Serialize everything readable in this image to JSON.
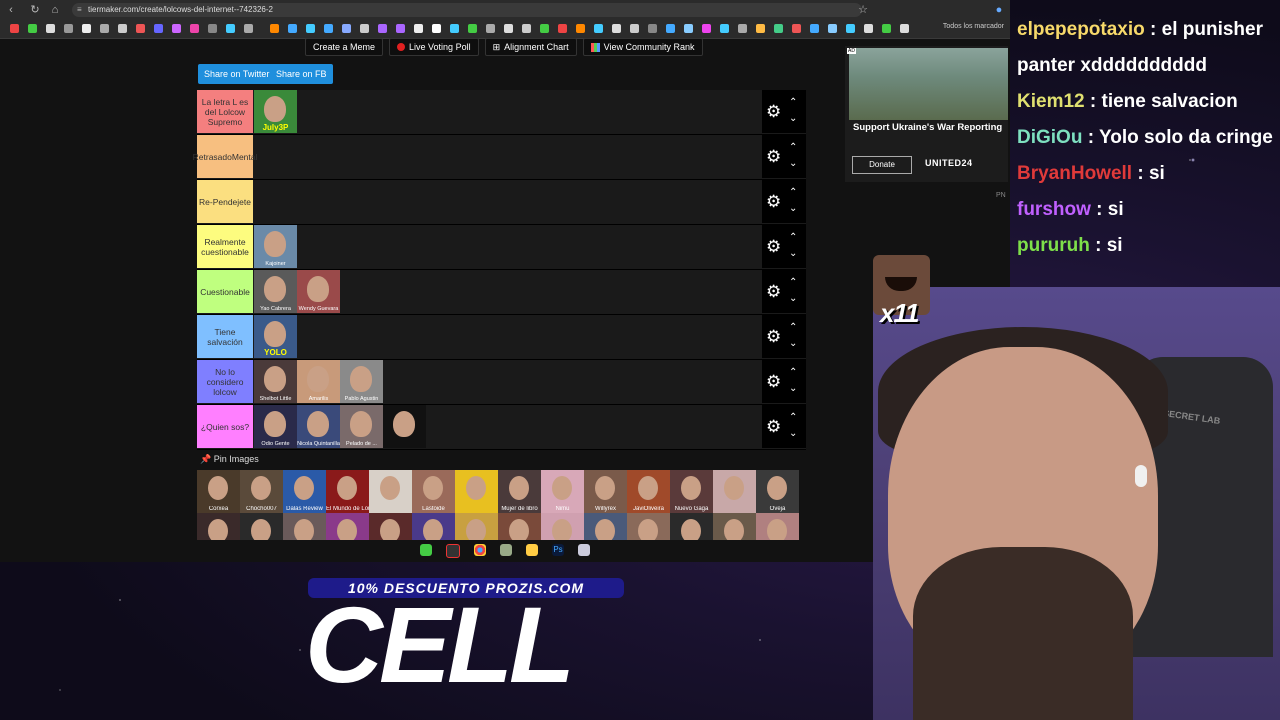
{
  "browser": {
    "url": "tiermaker.com/create/lolcows-del-internet--742326-2",
    "bookmarks_overflow": "Todos los marcador"
  },
  "page": {
    "top_buttons": [
      "Create a Meme",
      "Live Voting Poll",
      "Alignment Chart",
      "View Community Rank"
    ],
    "share_twitter": "Share on Twitter",
    "share_fb": "Share on FB",
    "pin_images": "Pin Images",
    "tiers": [
      {
        "label": "La letra L es del Lolcow Supremo",
        "color": "#f47f7f",
        "images": [
          {
            "caption": "July3P",
            "big": true,
            "bg": "#3a8a3a"
          }
        ]
      },
      {
        "label": "RetrasadoMental",
        "color": "#f7bf80",
        "images": []
      },
      {
        "label": "Re-Pendejete",
        "color": "#fbdf80",
        "images": []
      },
      {
        "label": "Realmente cuestionable",
        "color": "#fdfc7f",
        "images": [
          {
            "caption": "Kajoiner",
            "bg": "#6a8aa8"
          }
        ]
      },
      {
        "label": "Cuestionable",
        "color": "#bfff7f",
        "images": [
          {
            "caption": "Yao Cabrera",
            "bg": "#5a5a5a"
          },
          {
            "caption": "Wendy Guevara",
            "bg": "#9a4a4a"
          }
        ]
      },
      {
        "label": "Tiene salvación",
        "color": "#7fbfff",
        "images": [
          {
            "caption": "YOLO",
            "big": true,
            "bg": "#3a5a8a"
          }
        ]
      },
      {
        "label": "No lo considero lolcow",
        "color": "#7f7fff",
        "images": [
          {
            "caption": "Shelbot Little",
            "bg": "#4a3a3a"
          },
          {
            "caption": "Amarilis",
            "bg": "#c89a7a"
          },
          {
            "caption": "Pablo Agustin",
            "bg": "#8a8a8a"
          }
        ]
      },
      {
        "label": "¿Quien sos?",
        "color": "#ff7fff",
        "images": [
          {
            "caption": "Odio Gente",
            "bg": "#2a2a4a"
          },
          {
            "caption": "Nicola Quintanilla",
            "bg": "#3a4a7a"
          },
          {
            "caption": "Pelado de ...",
            "bg": "#7a6a6a"
          },
          {
            "caption": "",
            "bg": "#111111"
          }
        ]
      }
    ],
    "pool": [
      {
        "caption": "Corxea",
        "bg": "#4a3a2a"
      },
      {
        "caption": "Chocho007",
        "bg": "#5a4a3a"
      },
      {
        "caption": "Dalas Review",
        "bg": "#2a5aa8"
      },
      {
        "caption": "El Mundo de Lore",
        "bg": "#8a1a1a"
      },
      {
        "caption": "",
        "bg": "#d8d0c8"
      },
      {
        "caption": "Lastoide",
        "bg": "#9a6a5a"
      },
      {
        "caption": "",
        "bg": "#e8c020"
      },
      {
        "caption": "Mujer de libro",
        "bg": "#4a3a3a"
      },
      {
        "caption": "Nimu",
        "bg": "#d8a8b8"
      },
      {
        "caption": "Willyrex",
        "bg": "#7a5a4a"
      },
      {
        "caption": "JaviOliveira",
        "bg": "#a04a2a"
      },
      {
        "caption": "Nuevo Gaga",
        "bg": "#5a3a3a"
      },
      {
        "caption": "",
        "bg": "#c8a8a8"
      },
      {
        "caption": "Oveja",
        "bg": "#3a3a3a"
      },
      {
        "caption": "",
        "bg": "#3a2a2a"
      },
      {
        "caption": "",
        "bg": "#2a2a2a"
      },
      {
        "caption": "",
        "bg": "#6a5a5a"
      },
      {
        "caption": "",
        "bg": "#8a3a8a"
      },
      {
        "caption": "",
        "bg": "#5a2a2a"
      },
      {
        "caption": "",
        "bg": "#4a3a8a"
      },
      {
        "caption": "",
        "bg": "#c8a040"
      },
      {
        "caption": "",
        "bg": "#7a4a3a"
      },
      {
        "caption": "",
        "bg": "#d0a0b0"
      },
      {
        "caption": "",
        "bg": "#4a5a7a"
      },
      {
        "caption": "",
        "bg": "#8a6a5a"
      },
      {
        "caption": "",
        "bg": "#2a2a2a"
      },
      {
        "caption": "",
        "bg": "#6a5a4a"
      },
      {
        "caption": "",
        "bg": "#b08080"
      }
    ]
  },
  "ad": {
    "tag": "AD",
    "title": "Support Ukraine's War Reporting",
    "donate": "Donate",
    "brand": "UNITED24",
    "pn": "PN"
  },
  "chat": [
    {
      "user": "elpepepotaxio",
      "color": "#f7d96a",
      "text": "el punisher panter xdddddddddd"
    },
    {
      "user": "Kiem12",
      "color": "#e0e070",
      "text": "tiene salvacion"
    },
    {
      "user": "DiGiOu",
      "color": "#7ee0c0",
      "text": "Yolo solo da cringe"
    },
    {
      "user": "BryanHowell",
      "color": "#e03a3a",
      "text": "si"
    },
    {
      "user": "furshow",
      "color": "#c060ff",
      "text": "si"
    },
    {
      "user": "pururuh",
      "color": "#7ee04a",
      "text": "si"
    }
  ],
  "emote": {
    "count": "x11"
  },
  "cam": {
    "chair_text": "SECRET LAB"
  },
  "promo": {
    "top": "10% DESCUENTO PROZIS.COM",
    "big": "CELL"
  }
}
